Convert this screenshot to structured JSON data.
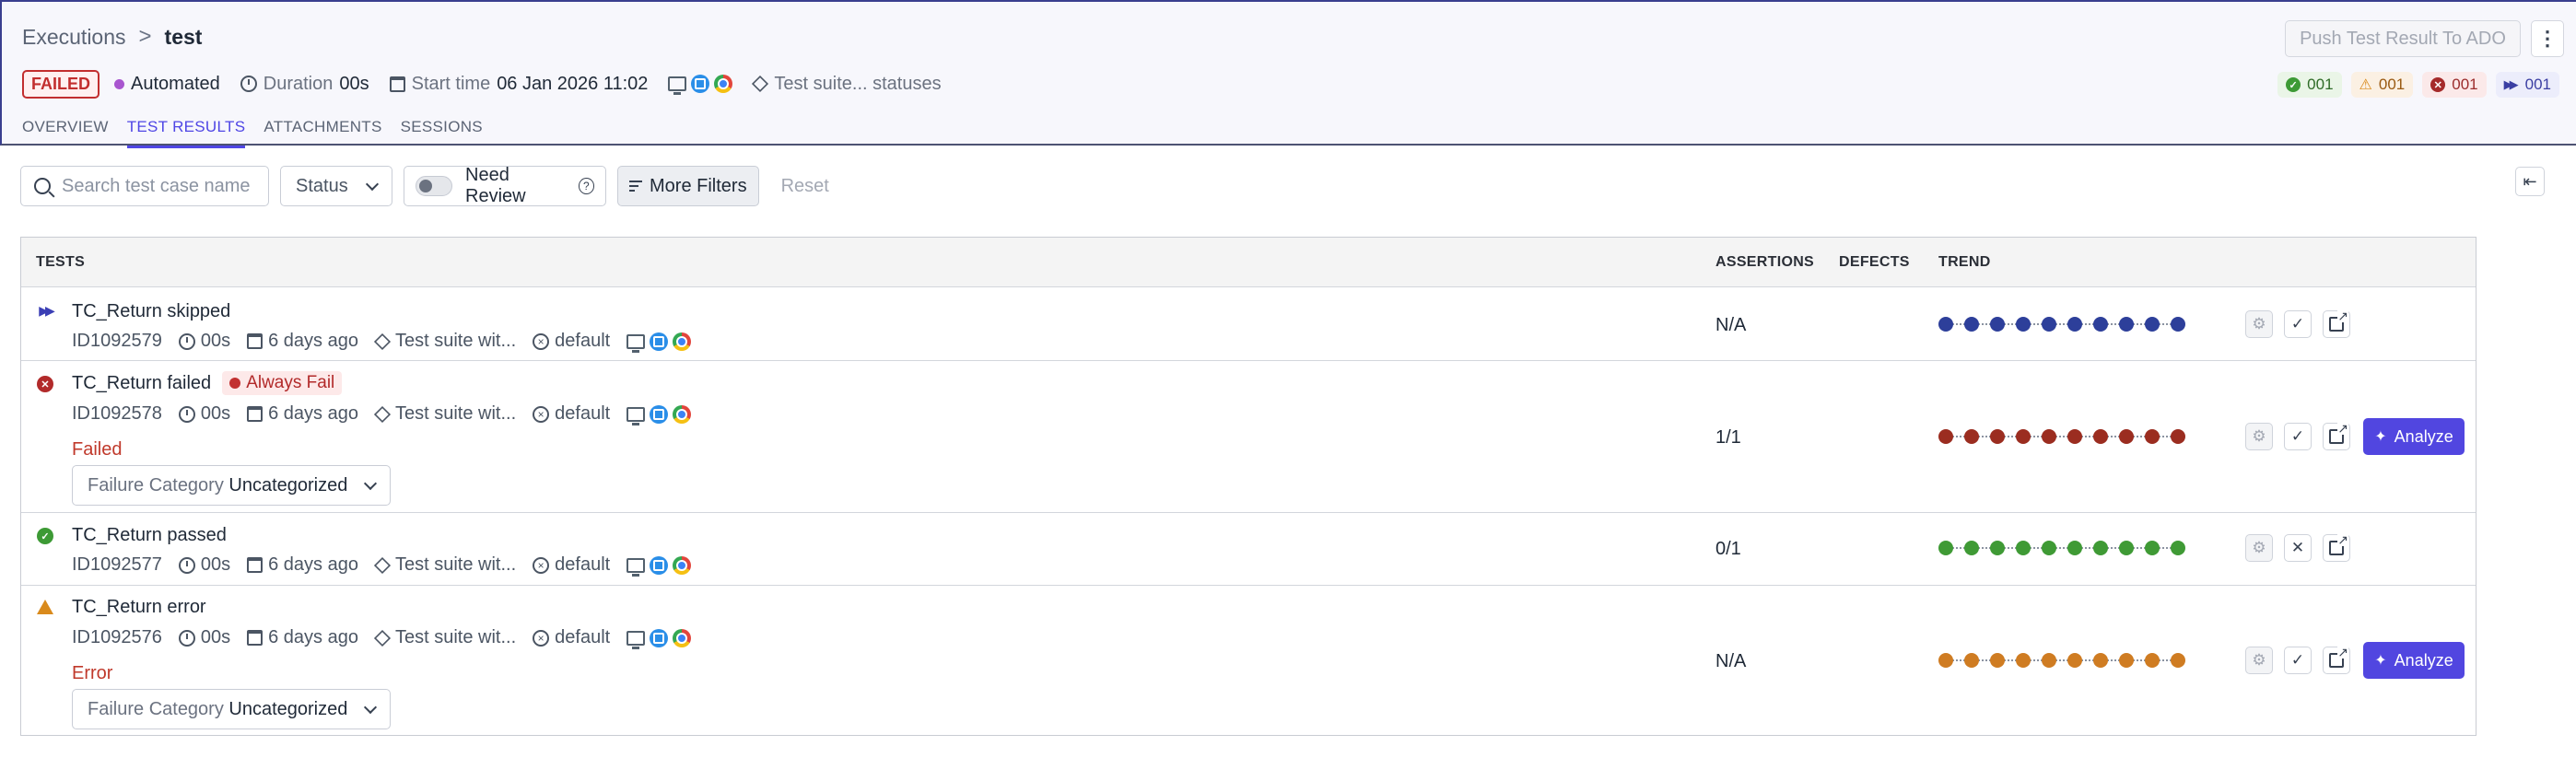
{
  "breadcrumb": {
    "parent": "Executions",
    "separator": ">",
    "current": "test"
  },
  "header": {
    "status_badge": "FAILED",
    "type": "Automated",
    "duration_label": "Duration",
    "duration_value": "00s",
    "start_label": "Start time",
    "start_value": "06 Jan 2026 11:02",
    "suite_status": "Test suite... statuses",
    "push_button": "Push Test Result To ADO"
  },
  "tabs": [
    {
      "label": "OVERVIEW"
    },
    {
      "label": "TEST RESULTS",
      "active": true
    },
    {
      "label": "ATTACHMENTS"
    },
    {
      "label": "SESSIONS"
    }
  ],
  "counts": {
    "passed": "001",
    "warning": "001",
    "failed": "001",
    "skipped": "001"
  },
  "filters": {
    "search_placeholder": "Search test case name",
    "status": "Status",
    "need_review": "Need Review",
    "more_filters": "More Filters",
    "reset": "Reset"
  },
  "table": {
    "headers": {
      "tests": "TESTS",
      "assertions": "ASSERTIONS",
      "defects": "DEFECTS",
      "trend": "TREND"
    },
    "rows": [
      {
        "status": "skipped",
        "name": "TC_Return skipped",
        "id": "ID1092579",
        "duration": "00s",
        "age": "6 days ago",
        "suite": "Test suite wit...",
        "profile": "default",
        "assertions": "N/A",
        "trend_color": "#2d3f9a",
        "check": "✓"
      },
      {
        "status": "failed",
        "name": "TC_Return failed",
        "tag": "Always Fail",
        "id": "ID1092578",
        "duration": "00s",
        "age": "6 days ago",
        "suite": "Test suite wit...",
        "profile": "default",
        "message": "Failed",
        "category_label": "Failure Category",
        "category_value": "Uncategorized",
        "assertions": "1/1",
        "trend_color": "#9b2d20",
        "check": "✓",
        "analyze": "Analyze"
      },
      {
        "status": "passed",
        "name": "TC_Return passed",
        "id": "ID1092577",
        "duration": "00s",
        "age": "6 days ago",
        "suite": "Test suite wit...",
        "profile": "default",
        "assertions": "0/1",
        "trend_color": "#3f9a35",
        "check": "✕"
      },
      {
        "status": "error",
        "name": "TC_Return error",
        "id": "ID1092576",
        "duration": "00s",
        "age": "6 days ago",
        "suite": "Test suite wit...",
        "profile": "default",
        "message": "Error",
        "category_label": "Failure Category",
        "category_value": "Uncategorized",
        "assertions": "N/A",
        "trend_color": "#cf7c22",
        "check": "✓",
        "analyze": "Analyze"
      }
    ]
  }
}
